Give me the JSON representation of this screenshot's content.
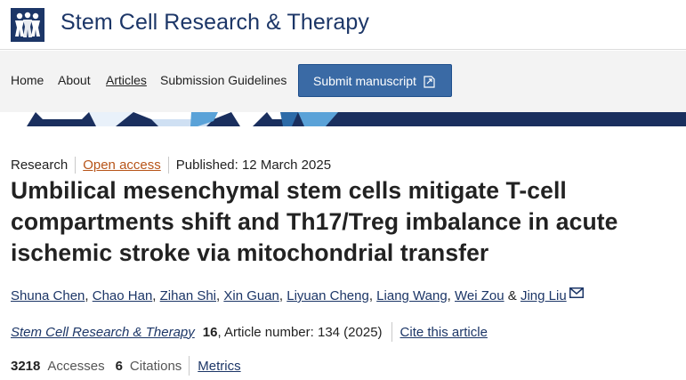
{
  "header": {
    "journal_title": "Stem Cell Research & Therapy",
    "brand_color": "#1c3667",
    "logo_icon": "people-group-logo-icon"
  },
  "nav": {
    "items": [
      {
        "label": "Home"
      },
      {
        "label": "About"
      },
      {
        "label": "Articles",
        "active": true
      },
      {
        "label": "Submission Guidelines"
      }
    ],
    "submit_label": "Submit manuscript",
    "submit_icon": "external-link-icon",
    "button_color": "#3a6aa5"
  },
  "article": {
    "type": "Research",
    "access": "Open access",
    "published": "Published: 12 March 2025",
    "title": "Umbilical mesenchymal stem cells mitigate T-cell compartments shift and Th17/Treg imbalance in acute ischemic stroke via mitochondrial transfer",
    "authors": [
      "Shuna Chen",
      "Chao Han",
      "Zihan Shi",
      "Xin Guan",
      "Liyuan Cheng",
      "Liang Wang",
      "Wei Zou",
      "Jing Liu"
    ],
    "and_sep": "&",
    "comma": ",",
    "correspondence_icon": "mail-icon",
    "citation": {
      "journal": "Stem Cell Research & Therapy",
      "volume": "16",
      "article_number": ", Article number: 134 (2025)",
      "cite_label": "Cite this article"
    },
    "metrics": {
      "accesses_count": "3218",
      "accesses_label": "Accesses",
      "citations_count": "6",
      "citations_label": "Citations",
      "metrics_label": "Metrics"
    },
    "open_access_color": "#b75418"
  }
}
